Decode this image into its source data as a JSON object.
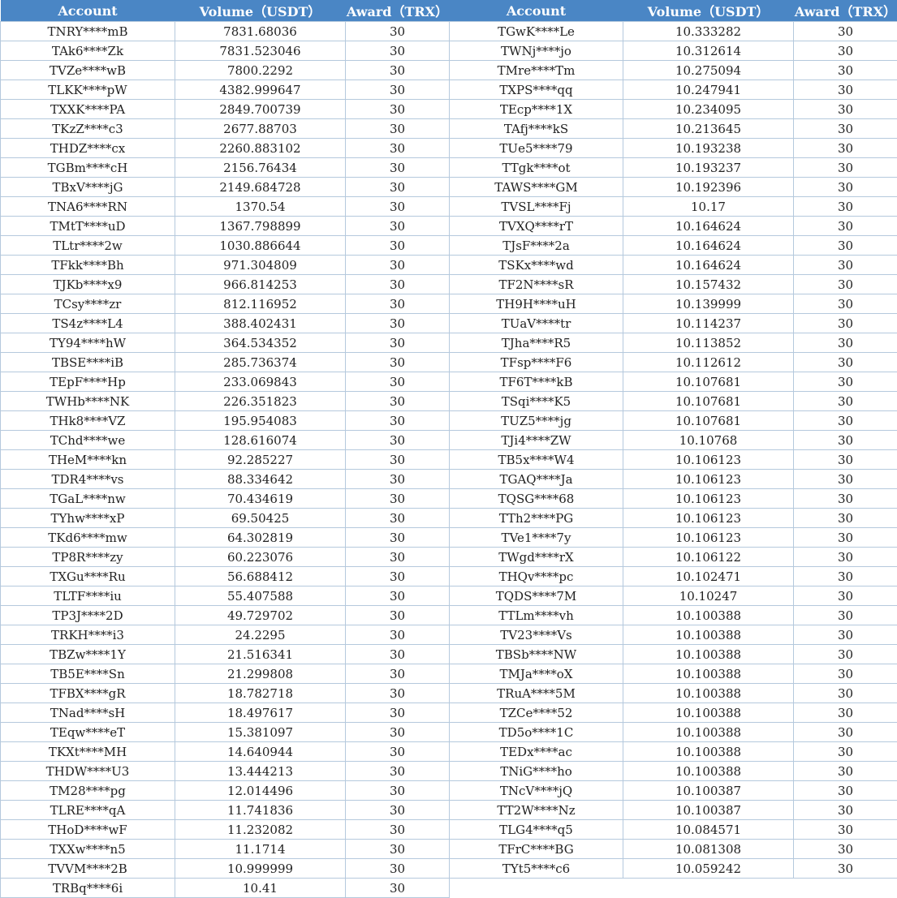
{
  "header": {
    "account": "Account",
    "volume": "Volume（USDT）",
    "award": "Award（TRX）"
  },
  "left": [
    [
      "TNRY****mB",
      "7831.68036",
      "30"
    ],
    [
      "TAk6****Zk",
      "7831.523046",
      "30"
    ],
    [
      "TVZe****wB",
      "7800.2292",
      "30"
    ],
    [
      "TLKK****pW",
      "4382.999647",
      "30"
    ],
    [
      "TXXK****PA",
      "2849.700739",
      "30"
    ],
    [
      "TKzZ****c3",
      "2677.88703",
      "30"
    ],
    [
      "THDZ****cx",
      "2260.883102",
      "30"
    ],
    [
      "TGBm****cH",
      "2156.76434",
      "30"
    ],
    [
      "TBxV****jG",
      "2149.684728",
      "30"
    ],
    [
      "TNA6****RN",
      "1370.54",
      "30"
    ],
    [
      "TMtT****uD",
      "1367.798899",
      "30"
    ],
    [
      "TLtr****2w",
      "1030.886644",
      "30"
    ],
    [
      "TFkk****Bh",
      "971.304809",
      "30"
    ],
    [
      "TJKb****x9",
      "966.814253",
      "30"
    ],
    [
      "TCsy****zr",
      "812.116952",
      "30"
    ],
    [
      "TS4z****L4",
      "388.402431",
      "30"
    ],
    [
      "TY94****hW",
      "364.534352",
      "30"
    ],
    [
      "TBSE****iB",
      "285.736374",
      "30"
    ],
    [
      "TEpF****Hp",
      "233.069843",
      "30"
    ],
    [
      "TWHb****NK",
      "226.351823",
      "30"
    ],
    [
      "THk8****VZ",
      "195.954083",
      "30"
    ],
    [
      "TChd****we",
      "128.616074",
      "30"
    ],
    [
      "THeM****kn",
      "92.285227",
      "30"
    ],
    [
      "TDR4****vs",
      "88.334642",
      "30"
    ],
    [
      "TGaL****nw",
      "70.434619",
      "30"
    ],
    [
      "TYhw****xP",
      "69.50425",
      "30"
    ],
    [
      "TKd6****mw",
      "64.302819",
      "30"
    ],
    [
      "TP8R****zy",
      "60.223076",
      "30"
    ],
    [
      "TXGu****Ru",
      "56.688412",
      "30"
    ],
    [
      "TLTF****iu",
      "55.407588",
      "30"
    ],
    [
      "TP3J****2D",
      "49.729702",
      "30"
    ],
    [
      "TRKH****i3",
      "24.2295",
      "30"
    ],
    [
      "TBZw****1Y",
      "21.516341",
      "30"
    ],
    [
      "TB5E****Sn",
      "21.299808",
      "30"
    ],
    [
      "TFBX****gR",
      "18.782718",
      "30"
    ],
    [
      "TNad****sH",
      "18.497617",
      "30"
    ],
    [
      "TEqw****eT",
      "15.381097",
      "30"
    ],
    [
      "TKXt****MH",
      "14.640944",
      "30"
    ],
    [
      "THDW****U3",
      "13.444213",
      "30"
    ],
    [
      "TM28****pg",
      "12.014496",
      "30"
    ],
    [
      "TLRE****qA",
      "11.741836",
      "30"
    ],
    [
      "THoD****wF",
      "11.232082",
      "30"
    ],
    [
      "TXXw****n5",
      "11.1714",
      "30"
    ],
    [
      "TVVM****2B",
      "10.999999",
      "30"
    ],
    [
      "TRBq****6i",
      "10.41",
      "30"
    ]
  ],
  "right": [
    [
      "TGwK****Le",
      "10.333282",
      "30"
    ],
    [
      "TWNj****jo",
      "10.312614",
      "30"
    ],
    [
      "TMre****Tm",
      "10.275094",
      "30"
    ],
    [
      "TXPS****qq",
      "10.247941",
      "30"
    ],
    [
      "TEcp****1X",
      "10.234095",
      "30"
    ],
    [
      "TAfj****kS",
      "10.213645",
      "30"
    ],
    [
      "TUe5****79",
      "10.193238",
      "30"
    ],
    [
      "TTgk****ot",
      "10.193237",
      "30"
    ],
    [
      "TAWS****GM",
      "10.192396",
      "30"
    ],
    [
      "TVSL****Fj",
      "10.17",
      "30"
    ],
    [
      "TVXQ****rT",
      "10.164624",
      "30"
    ],
    [
      "TJsF****2a",
      "10.164624",
      "30"
    ],
    [
      "TSKx****wd",
      "10.164624",
      "30"
    ],
    [
      "TF2N****sR",
      "10.157432",
      "30"
    ],
    [
      "TH9H****uH",
      "10.139999",
      "30"
    ],
    [
      "TUaV****tr",
      "10.114237",
      "30"
    ],
    [
      "TJha****R5",
      "10.113852",
      "30"
    ],
    [
      "TFsp****F6",
      "10.112612",
      "30"
    ],
    [
      "TF6T****kB",
      "10.107681",
      "30"
    ],
    [
      "TSqi****K5",
      "10.107681",
      "30"
    ],
    [
      "TUZ5****jg",
      "10.107681",
      "30"
    ],
    [
      "TJi4****ZW",
      "10.10768",
      "30"
    ],
    [
      "TB5x****W4",
      "10.106123",
      "30"
    ],
    [
      "TGAQ****Ja",
      "10.106123",
      "30"
    ],
    [
      "TQSG****68",
      "10.106123",
      "30"
    ],
    [
      "TTh2****PG",
      "10.106123",
      "30"
    ],
    [
      "TVe1****7y",
      "10.106123",
      "30"
    ],
    [
      "TWgd****rX",
      "10.106122",
      "30"
    ],
    [
      "THQv****pc",
      "10.102471",
      "30"
    ],
    [
      "TQDS****7M",
      "10.10247",
      "30"
    ],
    [
      "TTLm****vh",
      "10.100388",
      "30"
    ],
    [
      "TV23****Vs",
      "10.100388",
      "30"
    ],
    [
      "TBSb****NW",
      "10.100388",
      "30"
    ],
    [
      "TMJa****oX",
      "10.100388",
      "30"
    ],
    [
      "TRuA****5M",
      "10.100388",
      "30"
    ],
    [
      "TZCe****52",
      "10.100388",
      "30"
    ],
    [
      "TD5o****1C",
      "10.100388",
      "30"
    ],
    [
      "TEDx****ac",
      "10.100388",
      "30"
    ],
    [
      "TNiG****ho",
      "10.100388",
      "30"
    ],
    [
      "TNcV****jQ",
      "10.100387",
      "30"
    ],
    [
      "TT2W****Nz",
      "10.100387",
      "30"
    ],
    [
      "TLG4****q5",
      "10.084571",
      "30"
    ],
    [
      "TFrC****BG",
      "10.081308",
      "30"
    ],
    [
      "TYt5****c6",
      "10.059242",
      "30"
    ]
  ]
}
